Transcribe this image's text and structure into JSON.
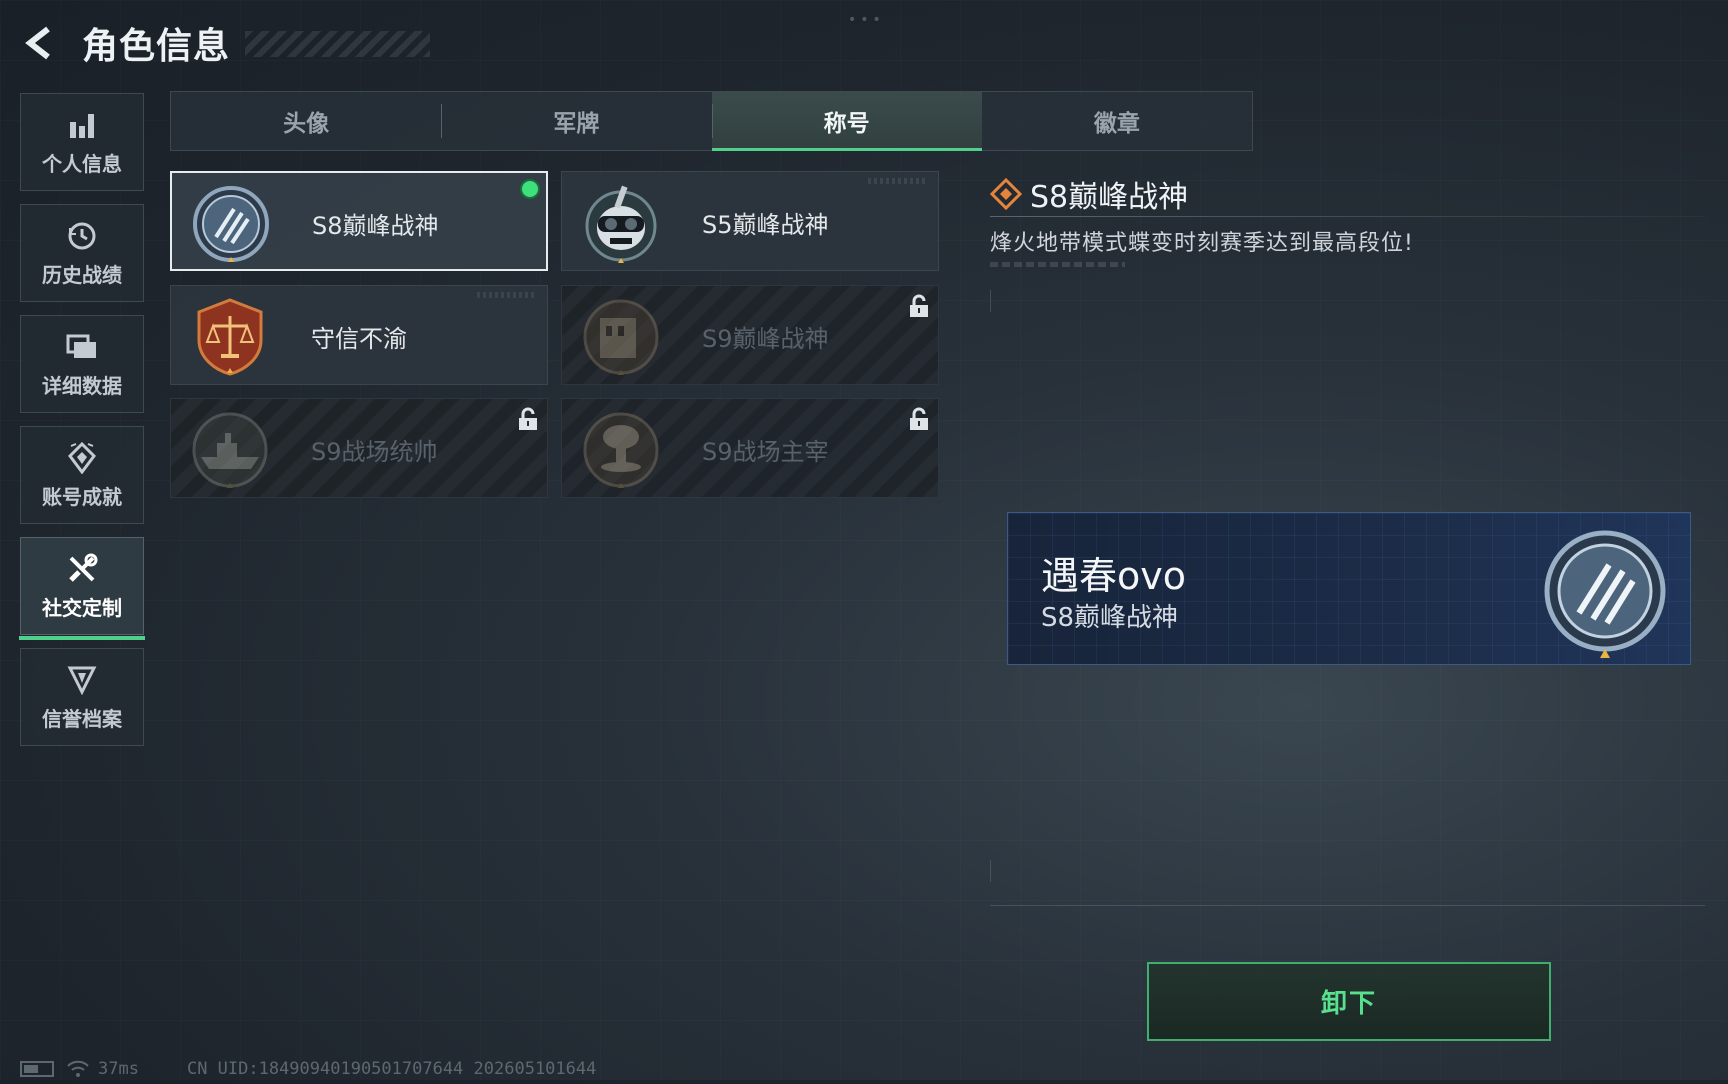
{
  "header": {
    "title": "角色信息"
  },
  "sidebar": {
    "items": [
      {
        "label": "个人信息",
        "icon": "bar-chart-icon",
        "active": false
      },
      {
        "label": "历史战绩",
        "icon": "history-clock-icon",
        "active": false
      },
      {
        "label": "详细数据",
        "icon": "folder-icon",
        "active": false
      },
      {
        "label": "账号成就",
        "icon": "achievement-icon",
        "active": false
      },
      {
        "label": "社交定制",
        "icon": "tools-icon",
        "active": true
      },
      {
        "label": "信誉档案",
        "icon": "credit-shield-icon",
        "active": false
      }
    ]
  },
  "tabs": [
    {
      "label": "头像",
      "active": false
    },
    {
      "label": "军牌",
      "active": false
    },
    {
      "label": "称号",
      "active": true
    },
    {
      "label": "徽章",
      "active": false
    }
  ],
  "titles": [
    {
      "label": "S8巅峰战神",
      "state": "equipped",
      "badge": "s8-peak-badge-icon"
    },
    {
      "label": "S5巅峰战神",
      "state": "owned",
      "badge": "skull-goggles-badge-icon"
    },
    {
      "label": "守信不渝",
      "state": "owned",
      "badge": "scales-badge-icon"
    },
    {
      "label": "S9巅峰战神",
      "state": "locked",
      "badge": "building-badge-icon"
    },
    {
      "label": "S9战场统帅",
      "state": "locked",
      "badge": "warship-badge-icon"
    },
    {
      "label": "S9战场主宰",
      "state": "locked",
      "badge": "mushroom-cloud-badge-icon"
    }
  ],
  "detail": {
    "title": "S8巅峰战神",
    "description": "烽火地带模式蝶变时刻赛季达到最高段位!"
  },
  "preview": {
    "player_name": "遇春ovo",
    "title": "S8巅峰战神"
  },
  "actions": {
    "unequip_label": "卸下"
  },
  "footer": {
    "ping": "37ms",
    "uid": "CN UID:18490940190501707644 202605101644"
  },
  "colors": {
    "accent_green": "#4fd08c",
    "banner_blue": "#1c2c47",
    "title_icon_orange": "#e7843b"
  }
}
